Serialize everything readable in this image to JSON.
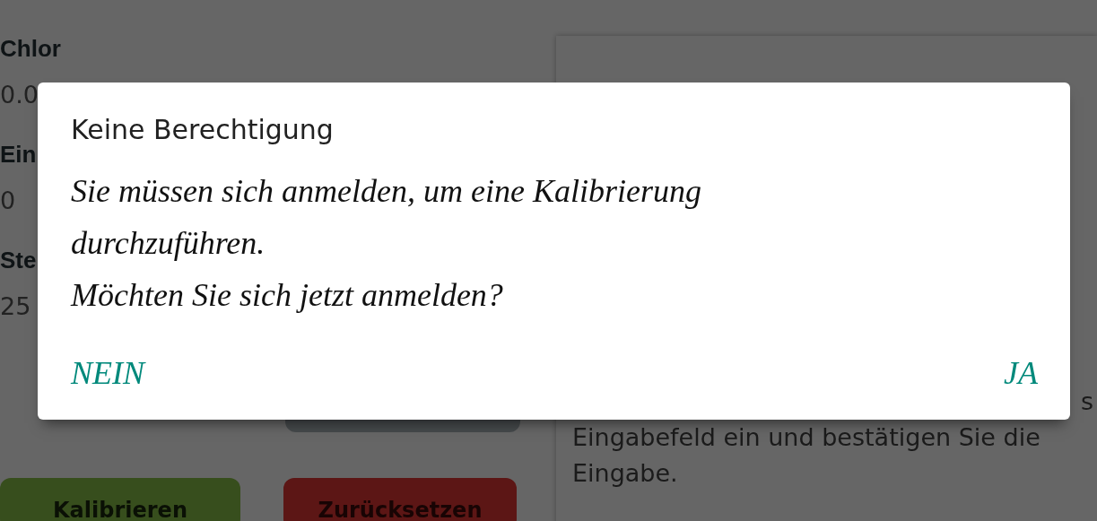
{
  "background": {
    "fields": [
      {
        "kind": "label",
        "text": "Chlor"
      },
      {
        "kind": "value",
        "text": "0.0"
      },
      {
        "kind": "label",
        "text": "Ein"
      },
      {
        "kind": "value",
        "text": "0"
      },
      {
        "kind": "label",
        "text": "Ste"
      },
      {
        "kind": "value",
        "text": "25"
      }
    ],
    "buttons": [
      {
        "kind": "secondary"
      },
      {
        "kind": "success",
        "label": "Kalibrieren"
      },
      {
        "kind": "danger",
        "label": "Zurücksetzen"
      }
    ],
    "help_panel": {
      "lines": [
        "s",
        "Eingabefeld ein und bestätigen Sie die",
        "Eingabe."
      ]
    }
  },
  "dialog": {
    "title": "Keine Berechtigung",
    "message": [
      "Sie müssen sich anmelden, um eine Kalibrierung durchzuführen.",
      "Möchten Sie sich jetzt anmelden?"
    ],
    "buttons": [
      {
        "label": "NEIN"
      },
      {
        "label": "JA"
      }
    ]
  }
}
